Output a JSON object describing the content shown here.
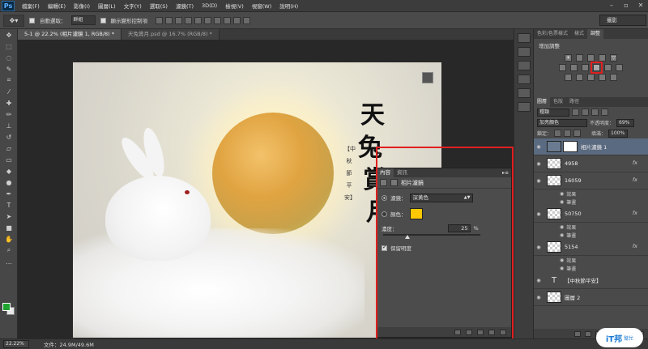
{
  "app": {
    "logo": "Ps"
  },
  "menu": [
    "檔案(F)",
    "編輯(E)",
    "影像(I)",
    "圖層(L)",
    "文字(Y)",
    "選取(S)",
    "濾鏡(T)",
    "3D(D)",
    "檢視(V)",
    "視窗(W)",
    "說明(H)"
  ],
  "options": {
    "auto_select_label": "自動選取：",
    "auto_select_value": "群組",
    "transform_label": "顯示變形控制項",
    "workspace": "攝影"
  },
  "tabs": [
    {
      "label": "5-1 @ 22.2% (相片濾鏡 1, RGB/8) *",
      "active": true
    },
    {
      "label": "天兔賞月.psd @ 16.7% (RGB/8) *",
      "active": false
    }
  ],
  "artwork": {
    "title_chars": [
      "天",
      "兔",
      "賞",
      "月"
    ],
    "subtitle": "【中秋節平安】"
  },
  "properties": {
    "tabs": [
      "內容",
      "資訊"
    ],
    "title": "相片濾鏡",
    "filter_label": "濾鏡：",
    "filter_value": "深黃色",
    "color_label": "顏色：",
    "color_value": "#ffc800",
    "density_label": "濃度：",
    "density_value": "25",
    "density_unit": "%",
    "density_fraction": 0.25,
    "preserve_label": "保留明度"
  },
  "right_panel": {
    "tabs": [
      "色彩/色票樣式",
      "樣式",
      "調整"
    ],
    "adjust_title": "增加調整"
  },
  "layers": {
    "tabs": [
      "圖層",
      "色版",
      "路徑"
    ],
    "kind": "種類",
    "blend": "加亮顏色",
    "opacity_label": "不透明度：",
    "opacity_value": "69%",
    "lock_label": "鎖定：",
    "fill_label": "填滿：",
    "fill_value": "100%",
    "effects_label": "效果",
    "stroke_label": "筆畫",
    "items": [
      {
        "name": "相片濾鏡 1",
        "type": "adj",
        "selected": true
      },
      {
        "name": "4958",
        "type": "layer"
      },
      {
        "name": "16059",
        "type": "layer"
      },
      {
        "name": "50750",
        "type": "layer"
      },
      {
        "name": "5154",
        "type": "layer"
      },
      {
        "name": "【中秋節平安】",
        "type": "text"
      },
      {
        "name": "圖層 2",
        "type": "layer"
      }
    ]
  },
  "status": {
    "zoom": "22.22%",
    "doc": "文件：24.9M/49.6M"
  },
  "watermark": {
    "main": "iT邦",
    "sub": "幫忙"
  }
}
